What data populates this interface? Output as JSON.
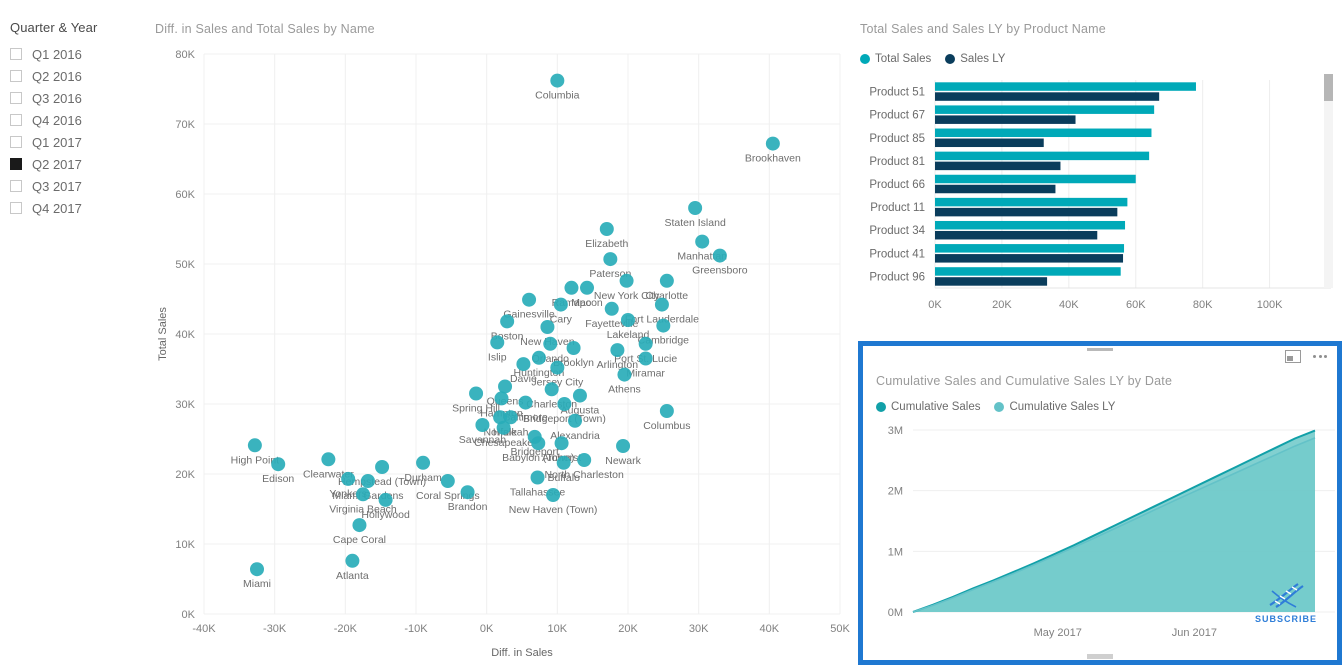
{
  "slicer": {
    "title": "Quarter & Year",
    "items": [
      {
        "label": "Q1 2016",
        "selected": false
      },
      {
        "label": "Q2 2016",
        "selected": false
      },
      {
        "label": "Q3 2016",
        "selected": false
      },
      {
        "label": "Q4 2016",
        "selected": false
      },
      {
        "label": "Q1 2017",
        "selected": false
      },
      {
        "label": "Q2 2017",
        "selected": true
      },
      {
        "label": "Q3 2017",
        "selected": false
      },
      {
        "label": "Q4 2017",
        "selected": false
      }
    ]
  },
  "colors": {
    "teal": "#29ADB8",
    "navy": "#0A3D5C",
    "area_fill": "#6CC8C8",
    "area_line_current": "#11A0A8",
    "area_line_ly": "#63C2C8",
    "selection_border": "#1F78D1"
  },
  "scatter": {
    "title": "Diff. in Sales and Total Sales by Name",
    "xlabel": "Diff. in Sales",
    "ylabel": "Total Sales",
    "xticks": [
      "-40K",
      "-30K",
      "-20K",
      "-10K",
      "0K",
      "10K",
      "20K",
      "30K",
      "40K",
      "50K"
    ],
    "yticks": [
      "0K",
      "10K",
      "20K",
      "30K",
      "40K",
      "50K",
      "60K",
      "70K",
      "80K"
    ]
  },
  "chart_data": [
    {
      "type": "scatter",
      "title": "Diff. in Sales and Total Sales by Name",
      "xlabel": "Diff. in Sales",
      "ylabel": "Total Sales",
      "xlim": [
        -40000,
        50000
      ],
      "ylim": [
        0,
        80000
      ],
      "grid": true,
      "points": [
        {
          "name": "Columbia",
          "x": 10000,
          "y": 76200
        },
        {
          "name": "Brookhaven",
          "x": 40500,
          "y": 67200
        },
        {
          "name": "Staten Island",
          "x": 29500,
          "y": 58000
        },
        {
          "name": "Manhattan",
          "x": 30500,
          "y": 53200
        },
        {
          "name": "Elizabeth",
          "x": 17000,
          "y": 55000
        },
        {
          "name": "Paterson",
          "x": 17500,
          "y": 50700
        },
        {
          "name": "Greensboro",
          "x": 33000,
          "y": 51200
        },
        {
          "name": "Ramapo",
          "x": 12000,
          "y": 46600
        },
        {
          "name": "Macon",
          "x": 14200,
          "y": 46600
        },
        {
          "name": "New York City",
          "x": 19800,
          "y": 47600
        },
        {
          "name": "Charlotte",
          "x": 25500,
          "y": 47600
        },
        {
          "name": "Cary",
          "x": 10500,
          "y": 44200
        },
        {
          "name": "Gainesville",
          "x": 6000,
          "y": 44900
        },
        {
          "name": "Fort Lauderdale",
          "x": 24800,
          "y": 44200
        },
        {
          "name": "Cambridge",
          "x": 25000,
          "y": 41200
        },
        {
          "name": "Fayetteville",
          "x": 17700,
          "y": 43600
        },
        {
          "name": "Lakeland",
          "x": 20000,
          "y": 42000
        },
        {
          "name": "Port St. Lucie",
          "x": 22500,
          "y": 38600
        },
        {
          "name": "New Haven",
          "x": 8600,
          "y": 41000
        },
        {
          "name": "Boston",
          "x": 2900,
          "y": 41800
        },
        {
          "name": "Orlando",
          "x": 9000,
          "y": 38600
        },
        {
          "name": "Brooklyn",
          "x": 12300,
          "y": 38000
        },
        {
          "name": "Arlington",
          "x": 18500,
          "y": 37700
        },
        {
          "name": "Miramar",
          "x": 22500,
          "y": 36500
        },
        {
          "name": "Islip",
          "x": 1500,
          "y": 38800
        },
        {
          "name": "Huntington",
          "x": 7400,
          "y": 36600
        },
        {
          "name": "Davie",
          "x": 5200,
          "y": 35700
        },
        {
          "name": "Jersey City",
          "x": 10000,
          "y": 35200
        },
        {
          "name": "Athens",
          "x": 19500,
          "y": 34200
        },
        {
          "name": "Charleston",
          "x": 9200,
          "y": 32100
        },
        {
          "name": "Augusta",
          "x": 13200,
          "y": 31200
        },
        {
          "name": "Queens",
          "x": 2600,
          "y": 32500
        },
        {
          "name": "Hampton",
          "x": 2100,
          "y": 30800
        },
        {
          "name": "Spring Hill",
          "x": -1500,
          "y": 31500
        },
        {
          "name": "Baltimore",
          "x": 5500,
          "y": 30200
        },
        {
          "name": "Bridgeport (Town)",
          "x": 11000,
          "y": 30000
        },
        {
          "name": "Columbus",
          "x": 25500,
          "y": 29000
        },
        {
          "name": "Norfolk",
          "x": 1900,
          "y": 28100
        },
        {
          "name": "Hialeah",
          "x": 3400,
          "y": 28100
        },
        {
          "name": "Savannah",
          "x": -600,
          "y": 27000
        },
        {
          "name": "Chesapeake",
          "x": 2400,
          "y": 26600
        },
        {
          "name": "Alexandria",
          "x": 12500,
          "y": 27600
        },
        {
          "name": "Bridgeport",
          "x": 6800,
          "y": 25300
        },
        {
          "name": "Babylon (Town)",
          "x": 7300,
          "y": 24400
        },
        {
          "name": "Amherst",
          "x": 10600,
          "y": 24400
        },
        {
          "name": "Newark",
          "x": 19300,
          "y": 24000
        },
        {
          "name": "North Charleston",
          "x": 13800,
          "y": 22000
        },
        {
          "name": "High Point",
          "x": -32800,
          "y": 24100
        },
        {
          "name": "Clearwater",
          "x": -22400,
          "y": 22100
        },
        {
          "name": "Hempstead (Town)",
          "x": -14800,
          "y": 21000
        },
        {
          "name": "Buffalo",
          "x": 10900,
          "y": 21600
        },
        {
          "name": "Durham",
          "x": -9000,
          "y": 21600
        },
        {
          "name": "Edison",
          "x": -29500,
          "y": 21400
        },
        {
          "name": "Yonkers",
          "x": -19600,
          "y": 19300
        },
        {
          "name": "Miami Gardens",
          "x": -16800,
          "y": 19000
        },
        {
          "name": "Coral Springs",
          "x": -5500,
          "y": 19000
        },
        {
          "name": "Tallahassee",
          "x": 7200,
          "y": 19500
        },
        {
          "name": "Brandon",
          "x": -2700,
          "y": 17400
        },
        {
          "name": "New Haven (Town)",
          "x": 9400,
          "y": 17000
        },
        {
          "name": "Virginia Beach",
          "x": -17500,
          "y": 17100
        },
        {
          "name": "Hollywood",
          "x": -14300,
          "y": 16300
        },
        {
          "name": "Cape Coral",
          "x": -18000,
          "y": 12700
        },
        {
          "name": "Atlanta",
          "x": -19000,
          "y": 7600
        },
        {
          "name": "Miami",
          "x": -32500,
          "y": 6400
        }
      ]
    },
    {
      "type": "bar",
      "title": "Total Sales and Sales LY by Product Name",
      "orientation": "horizontal",
      "categories": [
        "Product 51",
        "Product 67",
        "Product 85",
        "Product 81",
        "Product 66",
        "Product 11",
        "Product 34",
        "Product 41",
        "Product 96"
      ],
      "series": [
        {
          "name": "Total Sales",
          "color": "#00A9B8",
          "values": [
            78000,
            65500,
            64700,
            64000,
            60000,
            57500,
            56800,
            56500,
            55500
          ]
        },
        {
          "name": "Sales LY",
          "color": "#0A3D5C",
          "values": [
            67000,
            42000,
            32500,
            37500,
            36000,
            54500,
            48500,
            56200,
            33500
          ]
        }
      ],
      "xticks": [
        "0K",
        "20K",
        "40K",
        "60K",
        "80K",
        "100K"
      ],
      "xlim": [
        0,
        107000
      ],
      "grid": true,
      "legend_position": "top-left"
    },
    {
      "type": "area",
      "title": "Cumulative Sales and Cumulative Sales LY by Date",
      "xlabel": "",
      "ylabel": "",
      "yticks": [
        "0M",
        "1M",
        "2M",
        "3M"
      ],
      "ylim": [
        0,
        3000000
      ],
      "xticks": [
        "May 2017",
        "Jun 2017"
      ],
      "grid": true,
      "legend_position": "top-left",
      "series": [
        {
          "name": "Cumulative Sales",
          "color": "#11A0A8",
          "values": [
            0,
            120000,
            250000,
            390000,
            520000,
            660000,
            800000,
            950000,
            1100000,
            1260000,
            1420000,
            1580000,
            1740000,
            1900000,
            2060000,
            2220000,
            2380000,
            2540000,
            2700000,
            2860000,
            2990000
          ]
        },
        {
          "name": "Cumulative Sales LY",
          "color": "#63C2C8",
          "values": [
            0,
            110000,
            235000,
            370000,
            500000,
            635000,
            775000,
            920000,
            1065000,
            1215000,
            1370000,
            1525000,
            1680000,
            1835000,
            1985000,
            2135000,
            2285000,
            2435000,
            2585000,
            2735000,
            2870000
          ]
        }
      ]
    }
  ],
  "barchart": {
    "title": "Total Sales and Sales LY by Product Name",
    "legend": [
      {
        "label": "Total Sales",
        "color": "#00A9B8"
      },
      {
        "label": "Sales LY",
        "color": "#0A3D5C"
      }
    ]
  },
  "areachart": {
    "title": "Cumulative Sales and Cumulative Sales LY by Date",
    "legend": [
      {
        "label": "Cumulative Sales",
        "color": "#11A0A8"
      },
      {
        "label": "Cumulative Sales LY",
        "color": "#63C2C8"
      }
    ],
    "watermark": "SUBSCRIBE"
  }
}
